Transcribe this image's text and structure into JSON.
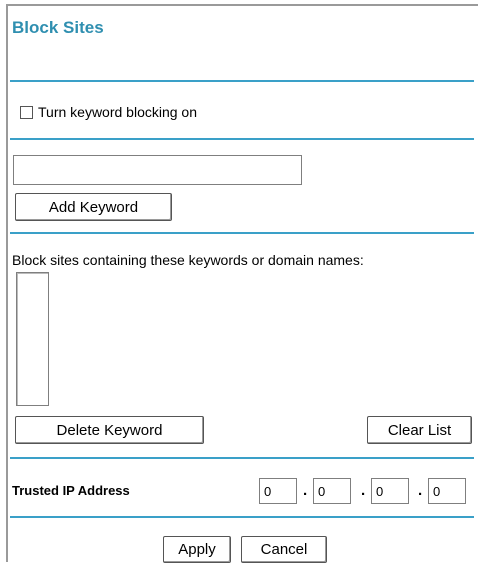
{
  "page": {
    "title": "Block Sites"
  },
  "keyword_blocking": {
    "checkbox_label": "Turn keyword blocking on",
    "checked": false
  },
  "keyword_input": {
    "value": ""
  },
  "buttons": {
    "add_keyword": "Add Keyword",
    "delete_keyword": "Delete Keyword",
    "clear_list": "Clear List",
    "apply": "Apply",
    "cancel": "Cancel"
  },
  "blocklist": {
    "heading": "Block sites containing these keywords or domain names:",
    "items": []
  },
  "trusted_ip": {
    "label": "Trusted IP Address",
    "octets": [
      "0",
      "0",
      "0",
      "0"
    ],
    "separator": "."
  },
  "colors": {
    "title": "#2f8fb0",
    "rule": "#3aa0c8"
  }
}
